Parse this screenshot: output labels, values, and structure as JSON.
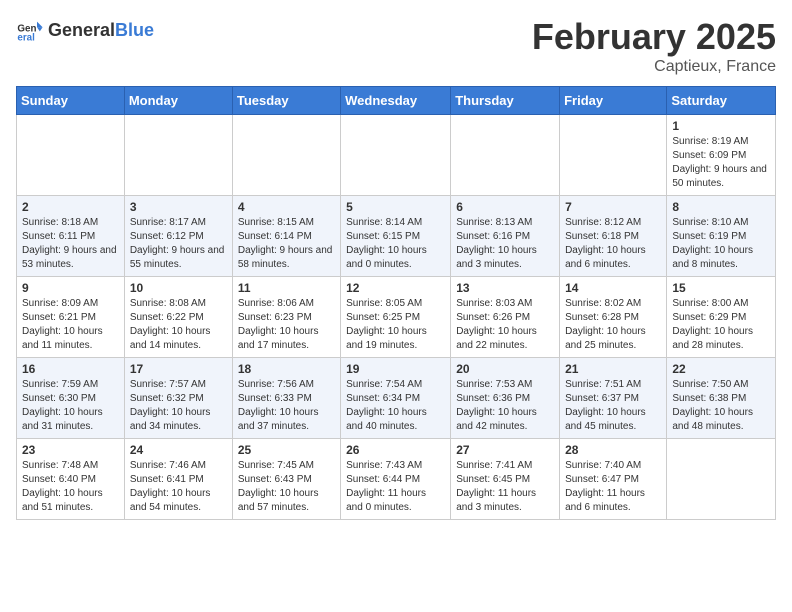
{
  "logo": {
    "text_general": "General",
    "text_blue": "Blue"
  },
  "title": "February 2025",
  "subtitle": "Captieux, France",
  "days_of_week": [
    "Sunday",
    "Monday",
    "Tuesday",
    "Wednesday",
    "Thursday",
    "Friday",
    "Saturday"
  ],
  "weeks": [
    [
      {
        "day": "",
        "info": ""
      },
      {
        "day": "",
        "info": ""
      },
      {
        "day": "",
        "info": ""
      },
      {
        "day": "",
        "info": ""
      },
      {
        "day": "",
        "info": ""
      },
      {
        "day": "",
        "info": ""
      },
      {
        "day": "1",
        "info": "Sunrise: 8:19 AM\nSunset: 6:09 PM\nDaylight: 9 hours and 50 minutes."
      }
    ],
    [
      {
        "day": "2",
        "info": "Sunrise: 8:18 AM\nSunset: 6:11 PM\nDaylight: 9 hours and 53 minutes."
      },
      {
        "day": "3",
        "info": "Sunrise: 8:17 AM\nSunset: 6:12 PM\nDaylight: 9 hours and 55 minutes."
      },
      {
        "day": "4",
        "info": "Sunrise: 8:15 AM\nSunset: 6:14 PM\nDaylight: 9 hours and 58 minutes."
      },
      {
        "day": "5",
        "info": "Sunrise: 8:14 AM\nSunset: 6:15 PM\nDaylight: 10 hours and 0 minutes."
      },
      {
        "day": "6",
        "info": "Sunrise: 8:13 AM\nSunset: 6:16 PM\nDaylight: 10 hours and 3 minutes."
      },
      {
        "day": "7",
        "info": "Sunrise: 8:12 AM\nSunset: 6:18 PM\nDaylight: 10 hours and 6 minutes."
      },
      {
        "day": "8",
        "info": "Sunrise: 8:10 AM\nSunset: 6:19 PM\nDaylight: 10 hours and 8 minutes."
      }
    ],
    [
      {
        "day": "9",
        "info": "Sunrise: 8:09 AM\nSunset: 6:21 PM\nDaylight: 10 hours and 11 minutes."
      },
      {
        "day": "10",
        "info": "Sunrise: 8:08 AM\nSunset: 6:22 PM\nDaylight: 10 hours and 14 minutes."
      },
      {
        "day": "11",
        "info": "Sunrise: 8:06 AM\nSunset: 6:23 PM\nDaylight: 10 hours and 17 minutes."
      },
      {
        "day": "12",
        "info": "Sunrise: 8:05 AM\nSunset: 6:25 PM\nDaylight: 10 hours and 19 minutes."
      },
      {
        "day": "13",
        "info": "Sunrise: 8:03 AM\nSunset: 6:26 PM\nDaylight: 10 hours and 22 minutes."
      },
      {
        "day": "14",
        "info": "Sunrise: 8:02 AM\nSunset: 6:28 PM\nDaylight: 10 hours and 25 minutes."
      },
      {
        "day": "15",
        "info": "Sunrise: 8:00 AM\nSunset: 6:29 PM\nDaylight: 10 hours and 28 minutes."
      }
    ],
    [
      {
        "day": "16",
        "info": "Sunrise: 7:59 AM\nSunset: 6:30 PM\nDaylight: 10 hours and 31 minutes."
      },
      {
        "day": "17",
        "info": "Sunrise: 7:57 AM\nSunset: 6:32 PM\nDaylight: 10 hours and 34 minutes."
      },
      {
        "day": "18",
        "info": "Sunrise: 7:56 AM\nSunset: 6:33 PM\nDaylight: 10 hours and 37 minutes."
      },
      {
        "day": "19",
        "info": "Sunrise: 7:54 AM\nSunset: 6:34 PM\nDaylight: 10 hours and 40 minutes."
      },
      {
        "day": "20",
        "info": "Sunrise: 7:53 AM\nSunset: 6:36 PM\nDaylight: 10 hours and 42 minutes."
      },
      {
        "day": "21",
        "info": "Sunrise: 7:51 AM\nSunset: 6:37 PM\nDaylight: 10 hours and 45 minutes."
      },
      {
        "day": "22",
        "info": "Sunrise: 7:50 AM\nSunset: 6:38 PM\nDaylight: 10 hours and 48 minutes."
      }
    ],
    [
      {
        "day": "23",
        "info": "Sunrise: 7:48 AM\nSunset: 6:40 PM\nDaylight: 10 hours and 51 minutes."
      },
      {
        "day": "24",
        "info": "Sunrise: 7:46 AM\nSunset: 6:41 PM\nDaylight: 10 hours and 54 minutes."
      },
      {
        "day": "25",
        "info": "Sunrise: 7:45 AM\nSunset: 6:43 PM\nDaylight: 10 hours and 57 minutes."
      },
      {
        "day": "26",
        "info": "Sunrise: 7:43 AM\nSunset: 6:44 PM\nDaylight: 11 hours and 0 minutes."
      },
      {
        "day": "27",
        "info": "Sunrise: 7:41 AM\nSunset: 6:45 PM\nDaylight: 11 hours and 3 minutes."
      },
      {
        "day": "28",
        "info": "Sunrise: 7:40 AM\nSunset: 6:47 PM\nDaylight: 11 hours and 6 minutes."
      },
      {
        "day": "",
        "info": ""
      }
    ]
  ]
}
